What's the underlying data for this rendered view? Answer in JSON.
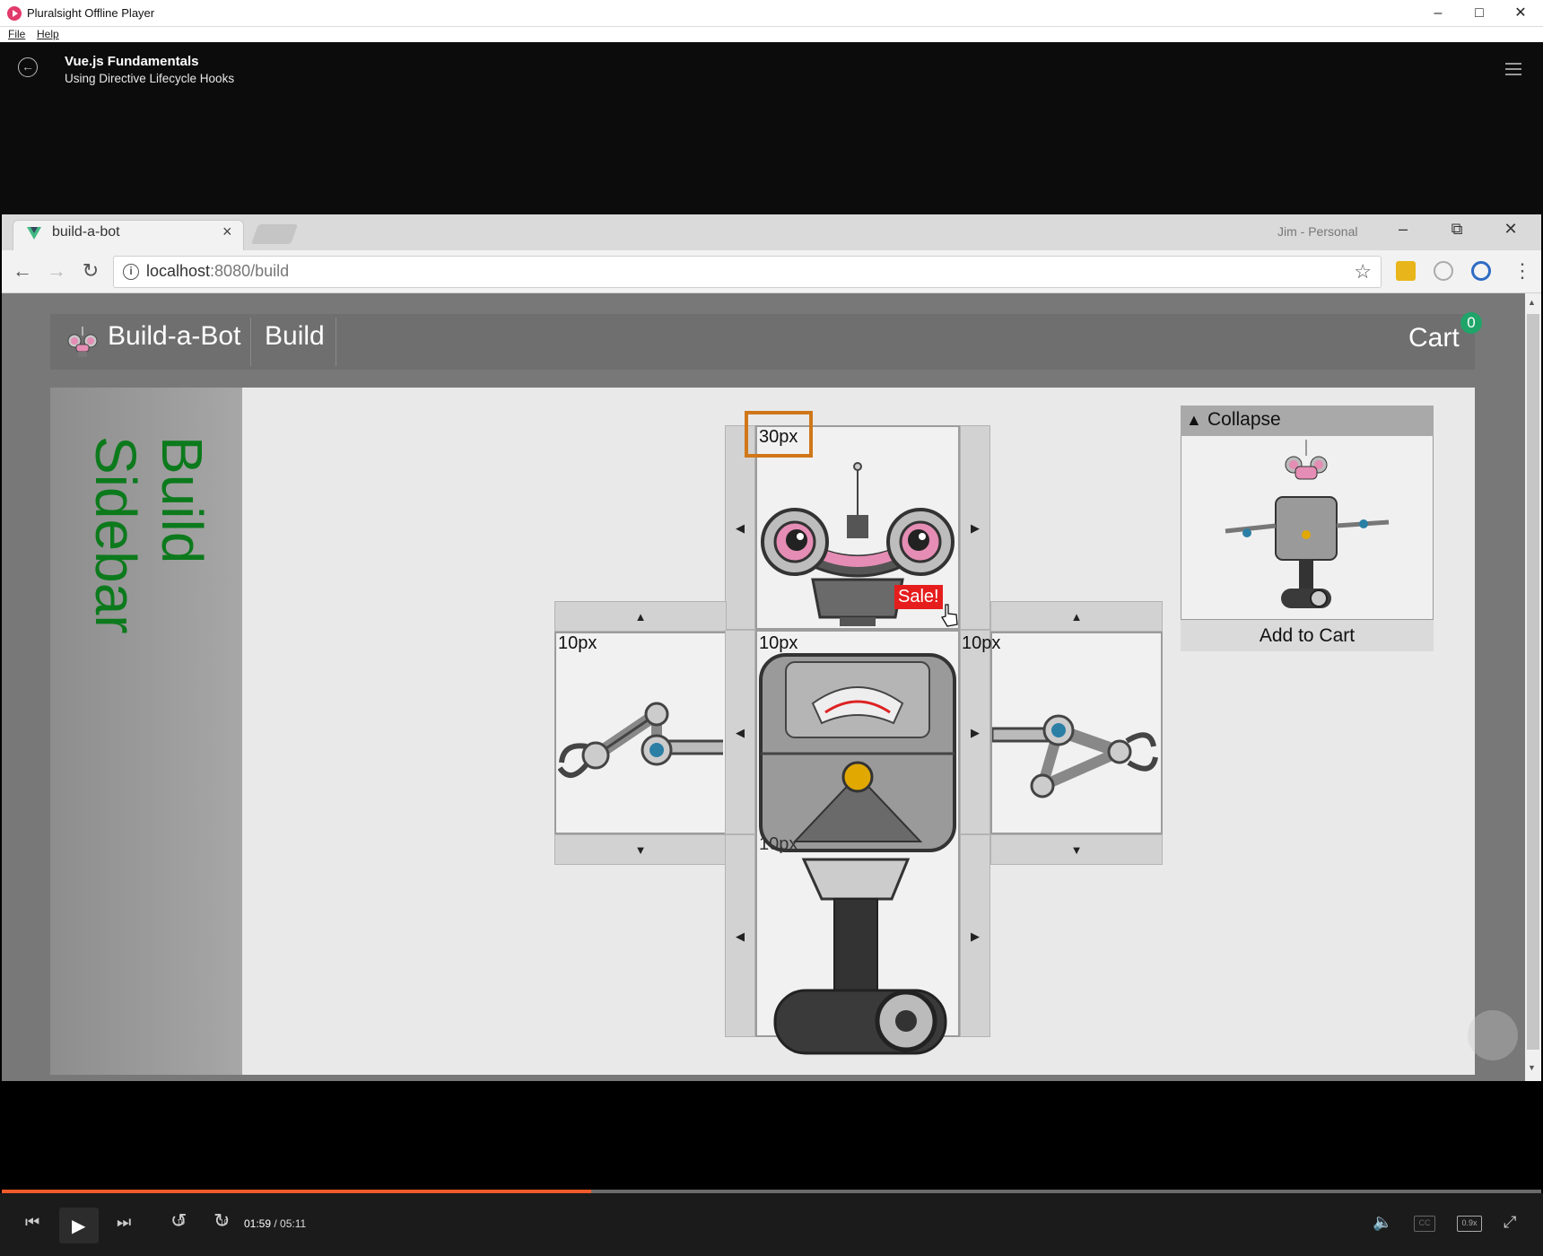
{
  "app": {
    "window_title": "Pluralsight Offline Player",
    "menu": [
      "File",
      "Help"
    ]
  },
  "course": {
    "title": "Vue.js Fundamentals",
    "clip": "Using Directive Lifecycle Hooks"
  },
  "browser": {
    "tab_title": "build-a-bot",
    "profile": "Jim - Personal",
    "url_host": "localhost",
    "url_rest": ":8080/build"
  },
  "site": {
    "brand": "Build-a-Bot",
    "nav_build": "Build",
    "cart_label": "Cart",
    "cart_count": "0",
    "sidebar_text": "Build Sidebar"
  },
  "builder": {
    "top_size": "30px",
    "left_size": "10px",
    "center_size": "10px",
    "right_size": "10px",
    "base_size": "10px",
    "sale_label": "Sale!",
    "arrow_up": "▲",
    "arrow_down": "▼",
    "arrow_left": "◀",
    "arrow_right": "▶"
  },
  "preview": {
    "collapse_label": "Collapse",
    "add_to_cart": "Add to Cart"
  },
  "player": {
    "current_time": "01:59",
    "total_time": "05:11",
    "progress": 0.383,
    "skip_back": "10",
    "skip_forward": "10",
    "cc": "CC",
    "speed": "0.9x"
  },
  "colors": {
    "accent": "#f15b2a",
    "highlight": "#d0771a",
    "sale": "#e61d1d",
    "sidebar_text": "#0c7a1c",
    "cart_badge": "#1fa56a"
  }
}
